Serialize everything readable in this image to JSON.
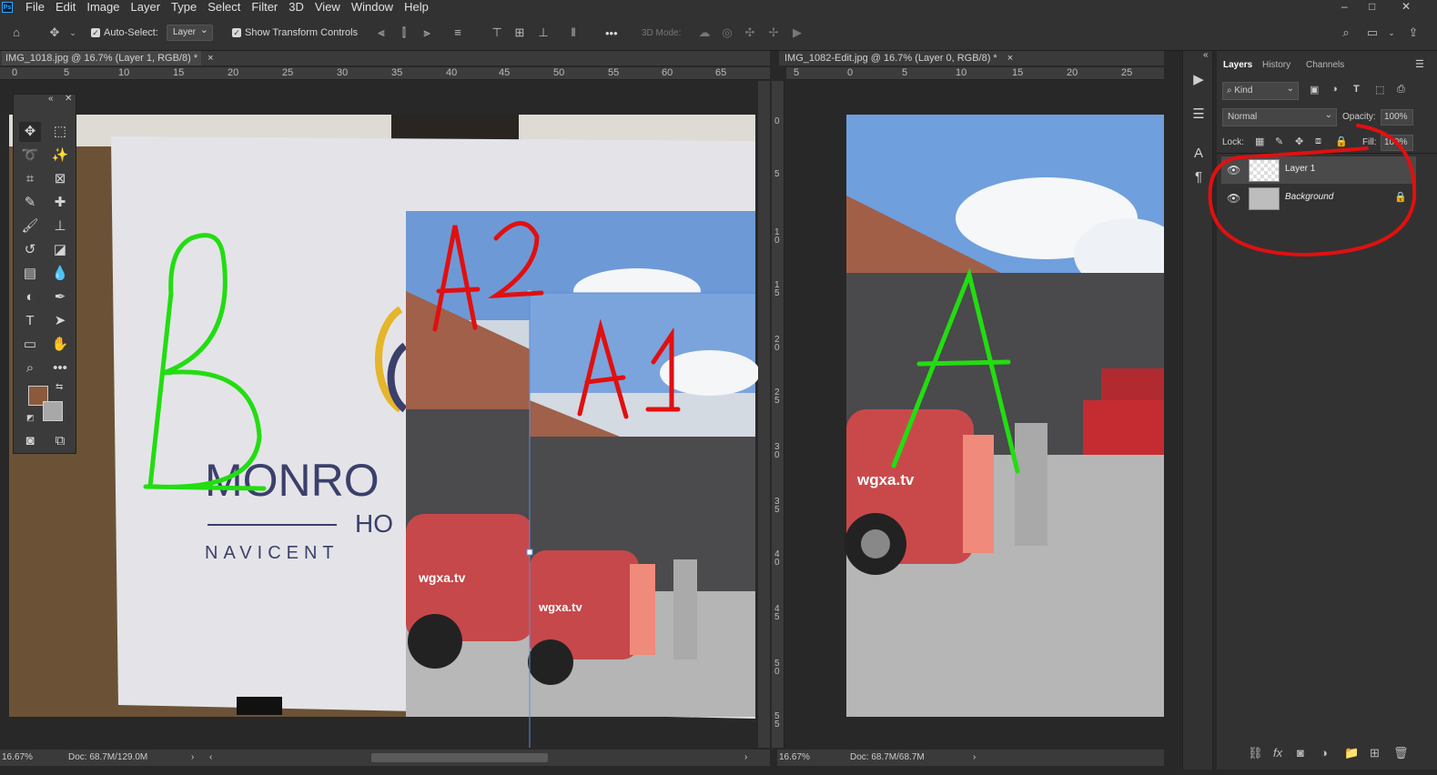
{
  "app": {
    "logo": "Ps"
  },
  "menu": [
    "File",
    "Edit",
    "Image",
    "Layer",
    "Type",
    "Select",
    "Filter",
    "3D",
    "View",
    "Window",
    "Help"
  ],
  "window_controls": {
    "minimize": "–",
    "maximize": "□",
    "close": "✕"
  },
  "options": {
    "auto_select_label": "Auto-Select:",
    "auto_select_value": "Layer",
    "show_transform_label": "Show Transform Controls",
    "mode_3d_label": "3D Mode:",
    "more": "•••"
  },
  "doc1": {
    "tab_title": "IMG_1018.jpg @ 16.7% (Layer 1, RGB/8) *",
    "close": "×",
    "ruler": [
      "0",
      "5",
      "10",
      "15",
      "20",
      "25",
      "30",
      "35",
      "40",
      "45",
      "50",
      "55",
      "60",
      "65"
    ],
    "zoom": "16.67%",
    "doc_info": "Doc: 68.7M/129.0M",
    "poster_text_1": "MONRO",
    "poster_text_2": "HO",
    "poster_text_3": "NAVICENT",
    "van_text": "wgxa.tv",
    "annotations": [
      "B",
      "A2",
      "A1"
    ]
  },
  "doc2": {
    "tab_title": "IMG_1082-Edit.jpg @ 16.7% (Layer 0, RGB/8) *",
    "close": "×",
    "ruler": [
      "5",
      "0",
      "5",
      "10",
      "15",
      "20",
      "25"
    ],
    "vruler": [
      "0",
      "5",
      "1\n0",
      "1\n5",
      "2\n0",
      "2\n5",
      "3\n0",
      "3\n5",
      "4\n0",
      "4\n5",
      "5\n0",
      "5\n5"
    ],
    "zoom": "16.67%",
    "doc_info": "Doc: 68.7M/68.7M",
    "van_text": "wgxa.tv",
    "annotation": "A"
  },
  "layers_panel": {
    "tabs": [
      "Layers",
      "History",
      "Channels"
    ],
    "filter_kind": "Kind",
    "blend_mode": "Normal",
    "opacity_label": "Opacity:",
    "opacity_value": "100%",
    "lock_label": "Lock:",
    "fill_label": "Fill:",
    "fill_value": "100%",
    "layers": [
      {
        "name": "Layer 1",
        "selected": true
      },
      {
        "name": "Background",
        "locked": true
      }
    ]
  },
  "colors": {
    "annotation_green": "#22dd11",
    "annotation_red": "#e01010",
    "circle_red": "#e01010",
    "foreground": "#8a5a3a",
    "background": "#a8a8a8"
  }
}
